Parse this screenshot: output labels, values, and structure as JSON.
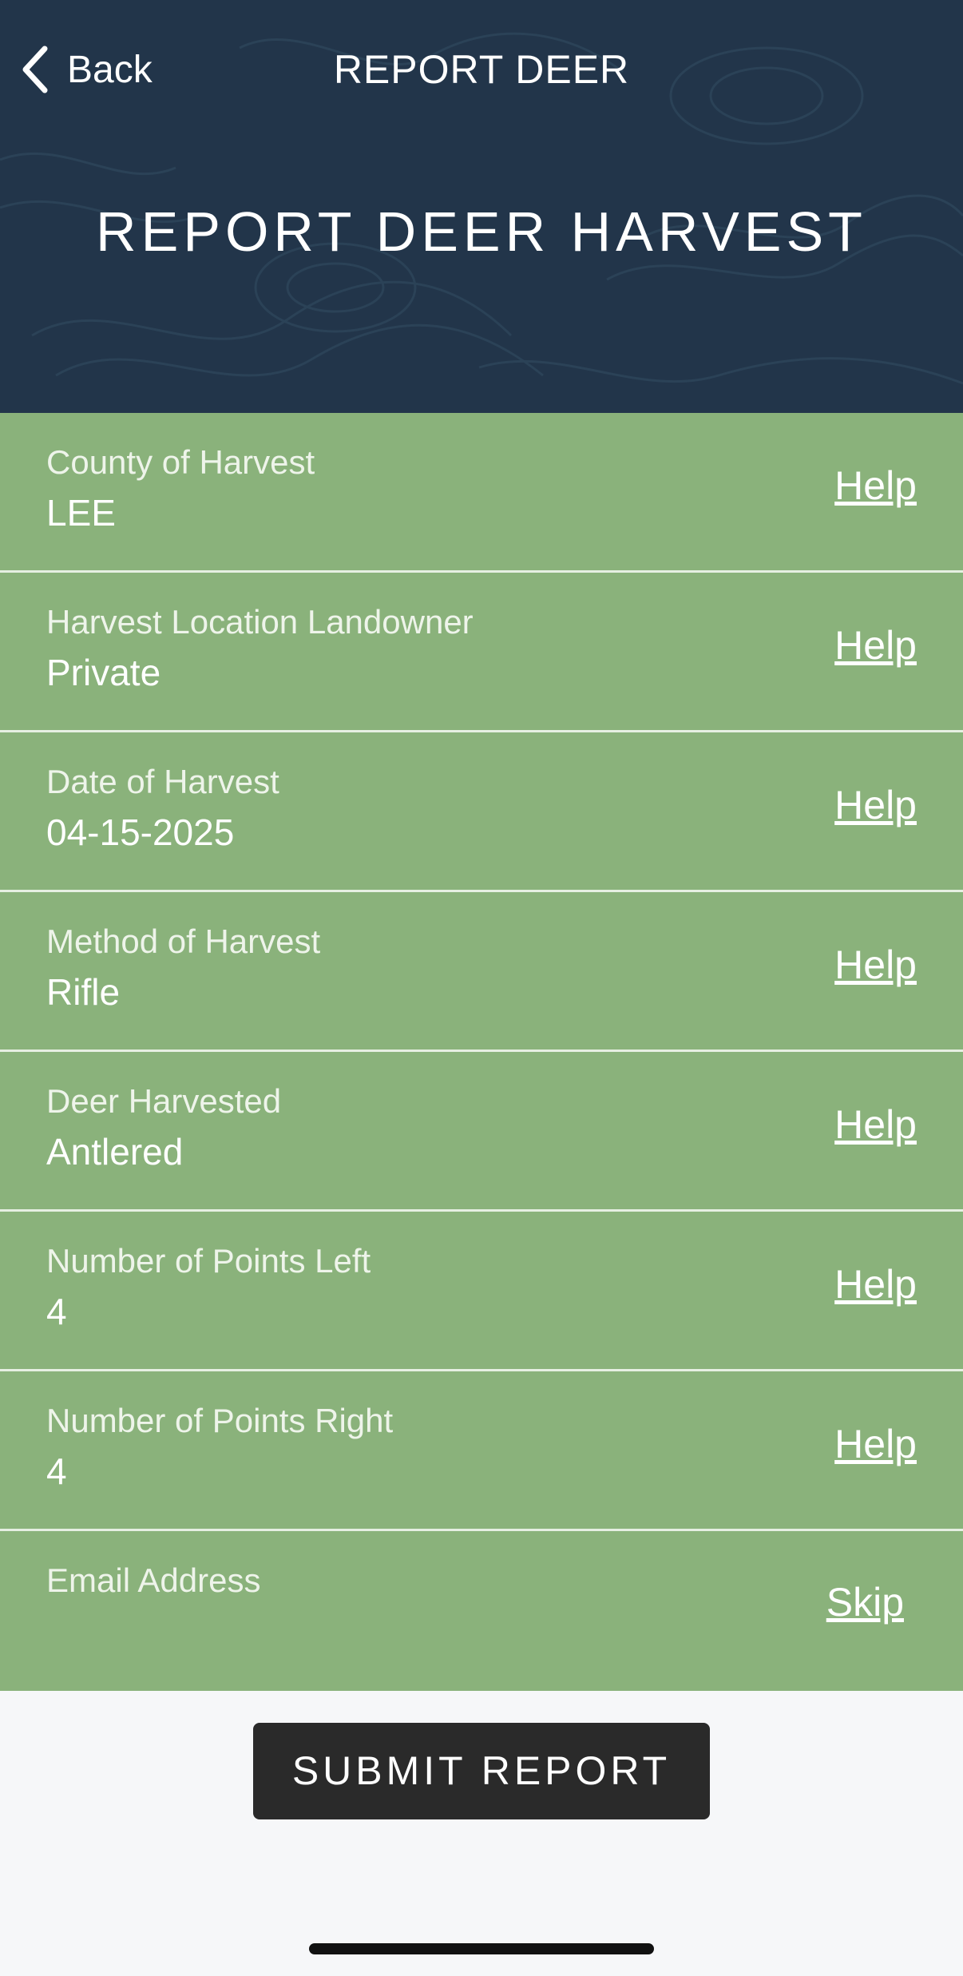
{
  "nav": {
    "back_label": "Back",
    "title": "REPORT DEER"
  },
  "header": {
    "title": "REPORT DEER HARVEST"
  },
  "fields": [
    {
      "label": "County of Harvest",
      "value": "LEE",
      "action": "Help"
    },
    {
      "label": "Harvest Location Landowner",
      "value": "Private",
      "action": "Help"
    },
    {
      "label": "Date of Harvest",
      "value": "04-15-2025",
      "action": "Help"
    },
    {
      "label": "Method of Harvest",
      "value": "Rifle",
      "action": "Help"
    },
    {
      "label": "Deer Harvested",
      "value": "Antlered",
      "action": "Help"
    },
    {
      "label": "Number of Points Left",
      "value": "4",
      "action": "Help"
    },
    {
      "label": "Number of Points Right",
      "value": "4",
      "action": "Help"
    },
    {
      "label": "Email Address",
      "value": "",
      "action": "Skip"
    }
  ],
  "submit_label": "SUBMIT REPORT",
  "colors": {
    "header_bg": "#22354a",
    "row_bg": "#8ab27b",
    "button_bg": "#2a2a2a",
    "page_bg": "#f6f7f9"
  },
  "icons": {
    "back": "chevron-left-icon"
  }
}
